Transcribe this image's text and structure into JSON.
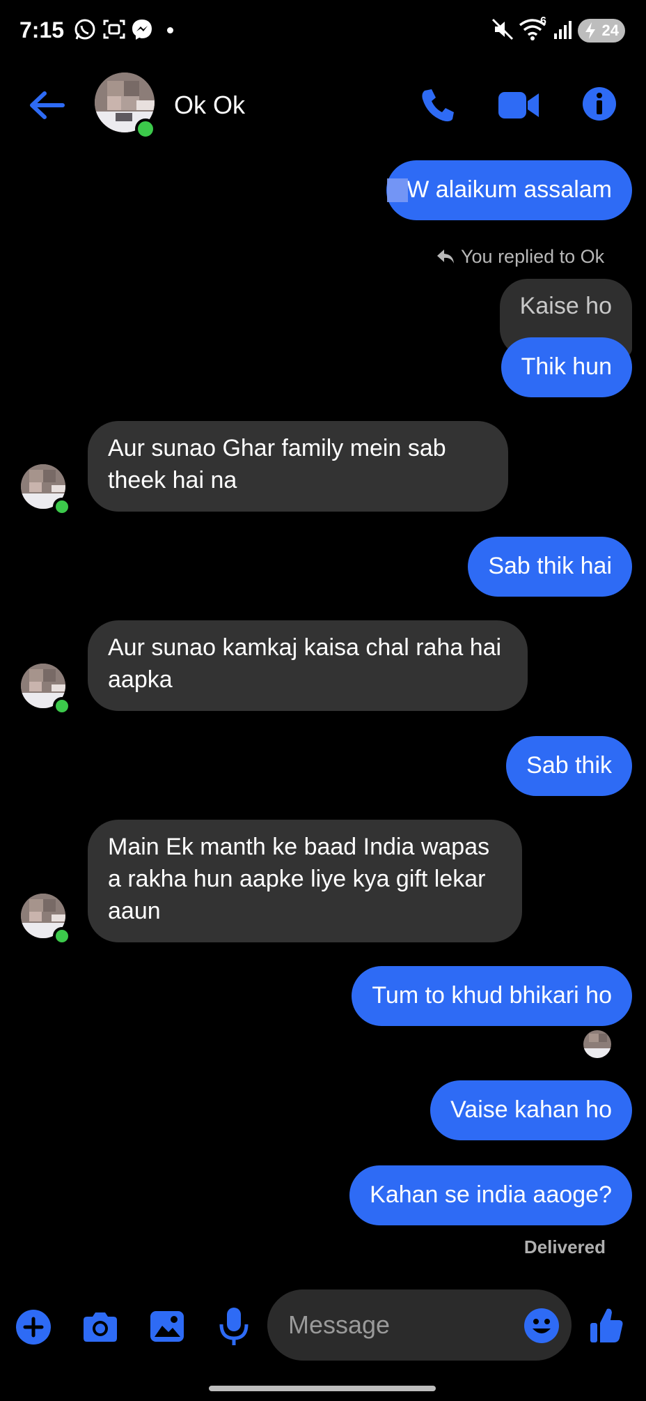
{
  "status_bar": {
    "time": "7:15",
    "battery": "24",
    "wifi_badge": "6"
  },
  "header": {
    "contact_name": "Ok Ok",
    "back_icon": "arrow-left-icon",
    "call_icon": "phone-icon",
    "video_icon": "video-camera-icon",
    "info_icon": "info-icon"
  },
  "conversation": {
    "messages": [
      {
        "from": "me",
        "text": "W   alaikum assalam"
      },
      {
        "from": "note",
        "text": "You replied to Ok"
      },
      {
        "from": "quoted",
        "text": "Kaise ho"
      },
      {
        "from": "me",
        "text": "Thik hun"
      },
      {
        "from": "them",
        "text": "Aur sunao Ghar family mein sab theek hai na"
      },
      {
        "from": "me",
        "text": "Sab thik hai"
      },
      {
        "from": "them",
        "text": "Aur sunao kamkaj kaisa chal raha hai aapka"
      },
      {
        "from": "me",
        "text": "Sab thik"
      },
      {
        "from": "them",
        "text": "Main Ek manth ke baad India wapas a rakha hun aapke liye kya gift lekar aaun"
      },
      {
        "from": "me",
        "text": "Tum to khud bhikari ho"
      },
      {
        "from": "me",
        "text": "Vaise kahan ho"
      },
      {
        "from": "me",
        "text": "Kahan se india aaoge?"
      }
    ],
    "status": "Delivered"
  },
  "composer": {
    "placeholder": "Message",
    "icons": [
      "plus-icon",
      "camera-icon",
      "image-icon",
      "microphone-icon",
      "emoji-icon",
      "thumbs-up-icon"
    ]
  },
  "colors": {
    "accent": "#2e6bf5",
    "outgoing_bubble": "#2e6bf5",
    "incoming_bubble": "#333333",
    "online": "#3cc94b",
    "background": "#000000"
  }
}
